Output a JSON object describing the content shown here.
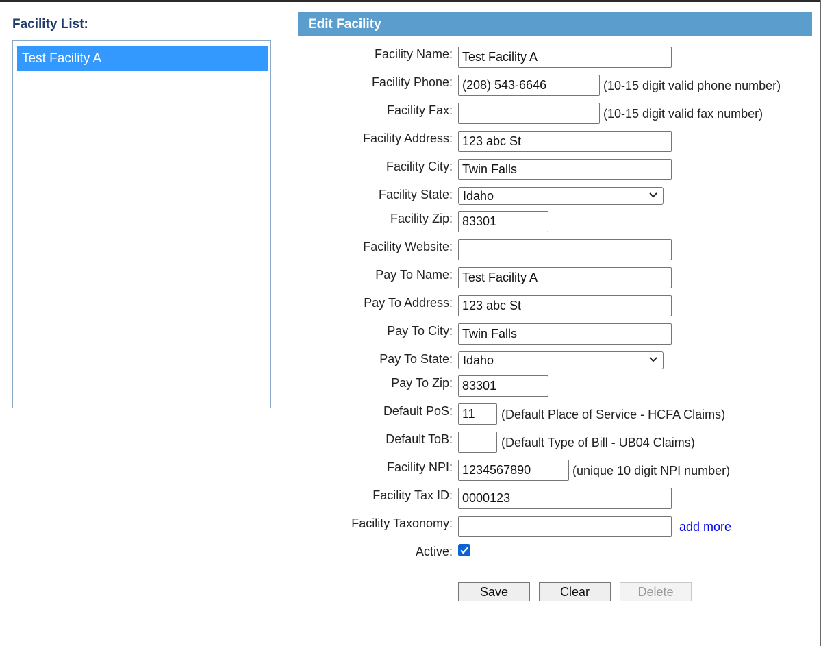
{
  "sidebar": {
    "title": "Facility List:",
    "items": [
      {
        "label": "Test Facility A"
      }
    ]
  },
  "form": {
    "header": "Edit Facility",
    "facility_name": {
      "label": "Facility Name:",
      "value": "Test Facility A"
    },
    "facility_phone": {
      "label": "Facility Phone:",
      "value": "(208) 543-6646",
      "hint": "(10-15 digit valid phone number)"
    },
    "facility_fax": {
      "label": "Facility Fax:",
      "value": "",
      "hint": "(10-15 digit valid fax number)"
    },
    "facility_address": {
      "label": "Facility Address:",
      "value": "123 abc St"
    },
    "facility_city": {
      "label": "Facility City:",
      "value": "Twin Falls"
    },
    "facility_state": {
      "label": "Facility State:",
      "value": "Idaho"
    },
    "facility_zip": {
      "label": "Facility Zip:",
      "value": "83301"
    },
    "facility_website": {
      "label": "Facility Website:",
      "value": ""
    },
    "pay_to_name": {
      "label": "Pay To Name:",
      "value": "Test Facility A"
    },
    "pay_to_address": {
      "label": "Pay To Address:",
      "value": "123 abc St"
    },
    "pay_to_city": {
      "label": "Pay To City:",
      "value": "Twin Falls"
    },
    "pay_to_state": {
      "label": "Pay To State:",
      "value": "Idaho"
    },
    "pay_to_zip": {
      "label": "Pay To Zip:",
      "value": "83301"
    },
    "default_pos": {
      "label": "Default PoS:",
      "value": "11",
      "hint": "(Default Place of Service - HCFA Claims)"
    },
    "default_tob": {
      "label": "Default ToB:",
      "value": "",
      "hint": "(Default Type of Bill - UB04 Claims)"
    },
    "facility_npi": {
      "label": "Facility NPI:",
      "value": "1234567890",
      "hint": "(unique 10 digit NPI number)"
    },
    "facility_tax_id": {
      "label": "Facility Tax ID:",
      "value": "0000123"
    },
    "facility_taxonomy": {
      "label": "Facility Taxonomy:",
      "value": "",
      "link": "add more"
    },
    "active": {
      "label": "Active:",
      "checked": true
    }
  },
  "buttons": {
    "save": "Save",
    "clear": "Clear",
    "delete": "Delete"
  },
  "colors": {
    "header_bg": "#5b9ece",
    "selected_item": "#3399ff",
    "link": "#0000ee",
    "checkbox": "#0b63d6"
  }
}
